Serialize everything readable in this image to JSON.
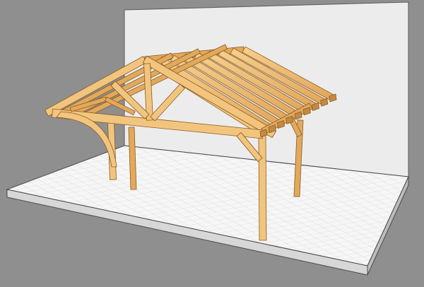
{
  "scene": {
    "subject": "timber-carport-pergola-3d-model",
    "colors": {
      "background": "#8f8f8f",
      "wall": "#ececec",
      "wall_edge": "#5a5a5a",
      "floor": "#f6f6f6",
      "floor_grid": "#d2d2d2",
      "floor_edge": "#4a4a4a",
      "floor_side": "#cfcfcf",
      "wood_light": "#f2c57e",
      "wood_mid": "#e2a95c",
      "wood_dark": "#c58a42",
      "wood_line": "#8a5a22"
    },
    "structure": {
      "rafter_count": 9,
      "post_count": 4
    }
  }
}
